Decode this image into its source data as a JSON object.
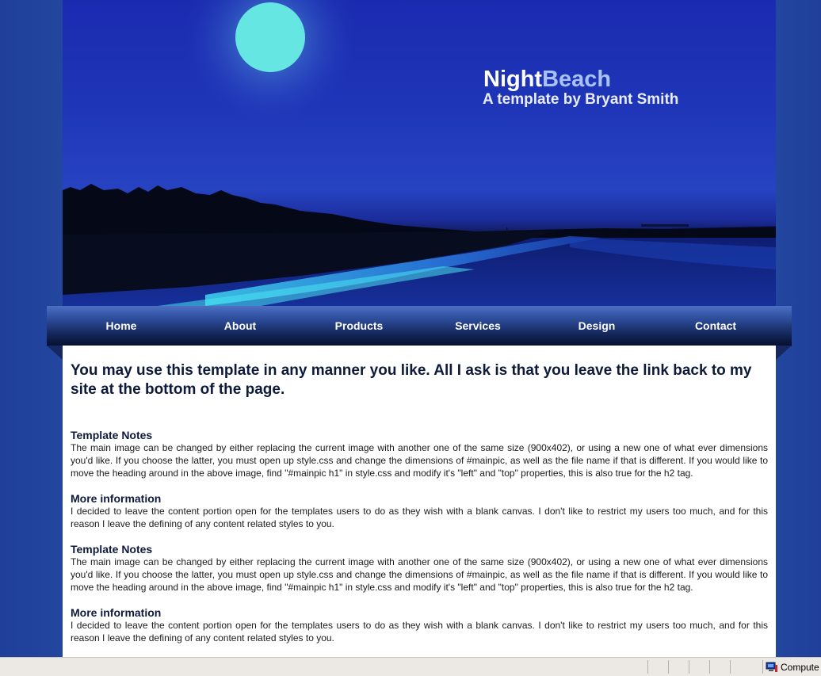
{
  "header": {
    "title_part1": "Night",
    "title_part2": "Beach",
    "subtitle": "A template by Bryant Smith"
  },
  "nav": {
    "items": [
      {
        "label": "Home"
      },
      {
        "label": "About"
      },
      {
        "label": "Products"
      },
      {
        "label": "Services"
      },
      {
        "label": "Design"
      },
      {
        "label": "Contact"
      }
    ]
  },
  "content": {
    "intro": "You may use this template in any manner you like. All I ask is that you leave the link back to my site at the bottom of the page.",
    "sections": [
      {
        "heading": "Template Notes",
        "body": "The main image can be changed by either replacing the current image with another one of the same size (900x402), or using a new one of what ever dimensions you'd like. If you choose the latter, you must open up style.css and change the dimensions of #mainpic, as well as the file name if that is different. If you would like to move the heading around in the above image, find \"#mainpic h1\" in style.css and modify it's \"left\" and \"top\" properties, this is also true for the h2 tag."
      },
      {
        "heading": "More information",
        "body": "I decided to leave the content portion open for the templates users to do as they wish with a blank canvas. I don't like to restrict my users too much, and for this reason I leave the defining of any content related styles to you."
      },
      {
        "heading": "Template Notes",
        "body": "The main image can be changed by either replacing the current image with another one of the same size (900x402), or using a new one of what ever dimensions you'd like. If you choose the latter, you must open up style.css and change the dimensions of #mainpic, as well as the file name if that is different. If you would like to move the heading around in the above image, find \"#mainpic h1\" in style.css and modify it's \"left\" and \"top\" properties, this is also true for the h2 tag."
      },
      {
        "heading": "More information",
        "body": "I decided to leave the content portion open for the templates users to do as they wish with a blank canvas. I don't like to restrict my users too much, and for this reason I leave the defining of any content related styles to you."
      }
    ]
  },
  "statusbar": {
    "zone_label": "Compute",
    "zone_icon": "computer-icon"
  },
  "colors": {
    "page_background": "#23469f",
    "title_accent": "#a9c2f4",
    "content_background": "#ffffff",
    "heading_text": "#0d1a3a"
  }
}
